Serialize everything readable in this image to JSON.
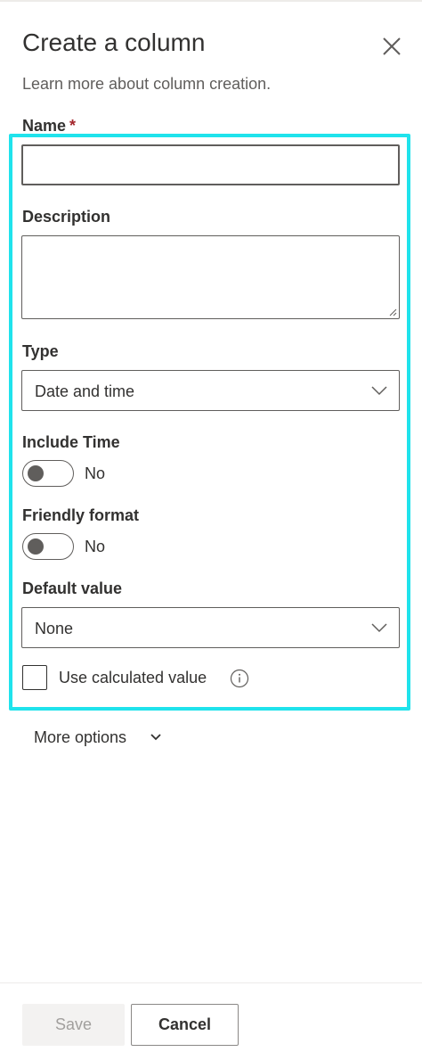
{
  "panel": {
    "title": "Create a column",
    "learn_more": "Learn more about column creation.",
    "close_icon": "close-icon"
  },
  "fields": {
    "name_label": "Name",
    "required_marker": "*",
    "name_value": "",
    "description_label": "Description",
    "description_value": "",
    "type_label": "Type",
    "type_value": "Date and time",
    "include_time_label": "Include Time",
    "include_time_state": "No",
    "friendly_format_label": "Friendly format",
    "friendly_format_state": "No",
    "default_value_label": "Default value",
    "default_value": "None",
    "use_calculated_label": "Use calculated value"
  },
  "more_options": "More options",
  "footer": {
    "save_label": "Save",
    "cancel_label": "Cancel"
  },
  "colors": {
    "highlight": "#1fe3ec",
    "required": "#a4262c",
    "text": "#323130",
    "secondary_text": "#605e5c"
  }
}
